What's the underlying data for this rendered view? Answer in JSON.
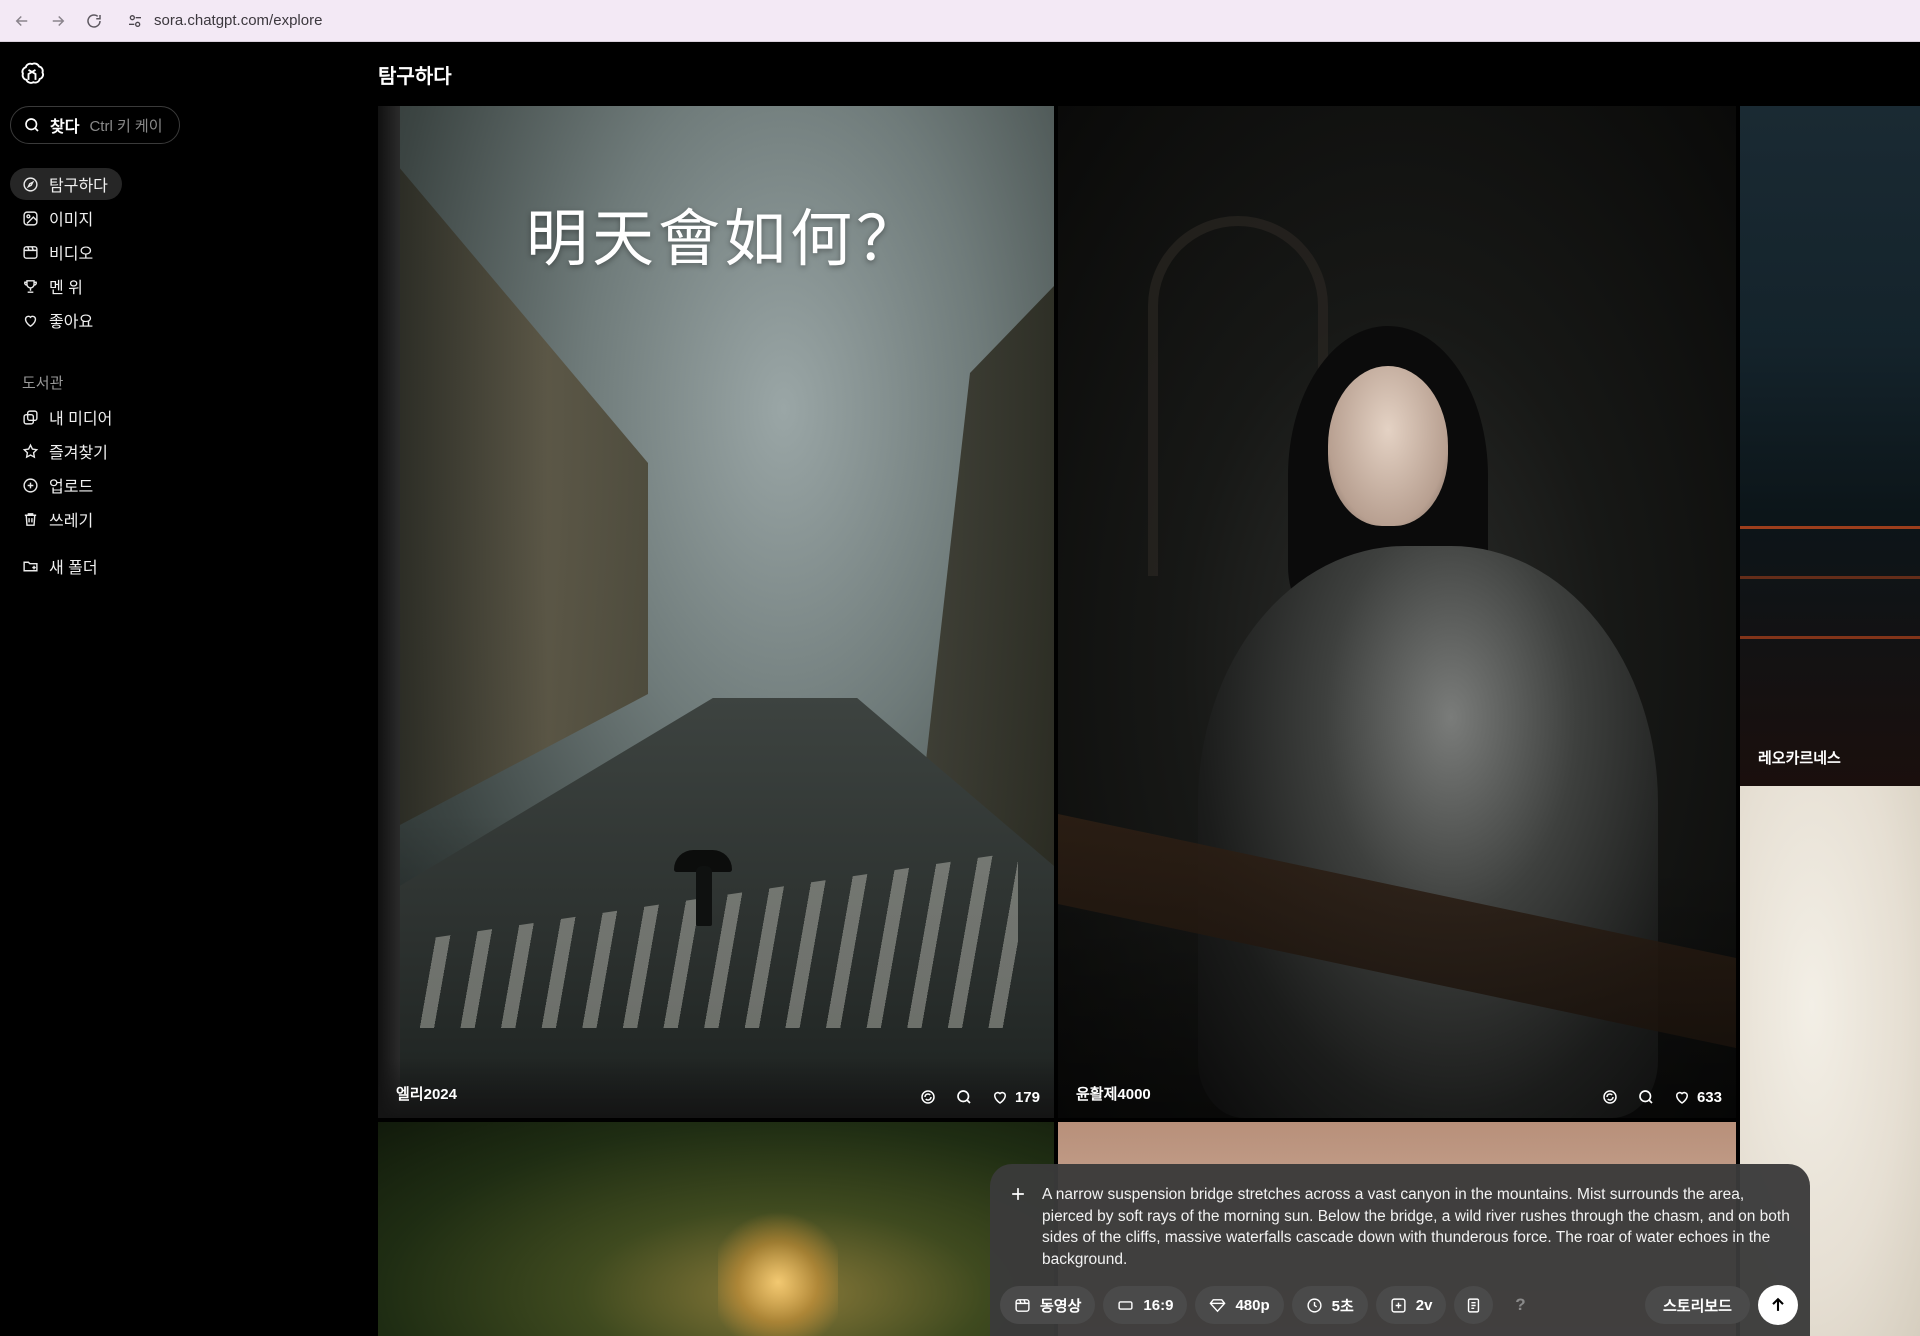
{
  "browser": {
    "url": "sora.chatgpt.com/explore"
  },
  "sidebar": {
    "search_label": "찾다",
    "search_shortcut": "Ctrl 키 케이",
    "nav": [
      {
        "label": "탐구하다",
        "icon": "compass-icon",
        "active": true
      },
      {
        "label": "이미지",
        "icon": "image-icon"
      },
      {
        "label": "비디오",
        "icon": "video-icon"
      },
      {
        "label": "멘 위",
        "icon": "trophy-icon"
      },
      {
        "label": "좋아요",
        "icon": "heart-icon"
      }
    ],
    "library_title": "도서관",
    "library": [
      {
        "label": "내 미디어",
        "icon": "media-icon"
      },
      {
        "label": "즐겨찾기",
        "icon": "star-icon"
      },
      {
        "label": "업로드",
        "icon": "upload-icon"
      },
      {
        "label": "쓰레기",
        "icon": "trash-icon"
      }
    ],
    "new_folder": "새 폴더"
  },
  "main": {
    "title": "탐구하다",
    "tiles": [
      {
        "author": "엘리2024",
        "likes": "179",
        "caption": "明天會如何？"
      },
      {
        "author": "윤활제4000",
        "likes": "633"
      },
      {
        "author": "레오카르네스"
      }
    ]
  },
  "composer": {
    "prompt": "A narrow suspension bridge stretches across a vast canyon in the mountains. Mist surrounds the area, pierced by soft rays of the morning sun. Below the bridge, a wild river rushes through the chasm, and on both sides of the cliffs, massive waterfalls cascade down with thunderous force. The roar of water echoes in the background.",
    "type": "동영상",
    "aspect": "16:9",
    "resolution": "480p",
    "duration": "5초",
    "variations": "2v",
    "help": "?",
    "storyboard": "스토리보드"
  }
}
